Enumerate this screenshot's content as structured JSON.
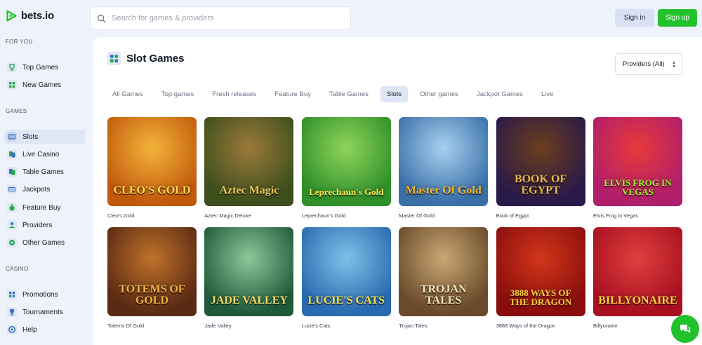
{
  "brand": {
    "name": "bets.io",
    "accent": "#22c22c"
  },
  "search": {
    "placeholder": "Search for games & providers"
  },
  "auth": {
    "signin": "Sign in",
    "signup": "Sign up"
  },
  "sidebar": {
    "sections": [
      {
        "title": "FOR YOU",
        "items": [
          {
            "label": "Top Games",
            "icon": "trophy-icon"
          },
          {
            "label": "New Games",
            "icon": "grid-icon"
          }
        ]
      },
      {
        "title": "GAMES",
        "items": [
          {
            "label": "Slots",
            "icon": "slots-icon",
            "active": true
          },
          {
            "label": "Live Casino",
            "icon": "cards-icon"
          },
          {
            "label": "Table Games",
            "icon": "table-icon"
          },
          {
            "label": "Jackpots",
            "icon": "jackpot-icon"
          },
          {
            "label": "Feature Buy",
            "icon": "bag-icon"
          },
          {
            "label": "Providers",
            "icon": "user-icon"
          },
          {
            "label": "Other Games",
            "icon": "circle-icon"
          }
        ]
      },
      {
        "title": "CASINO",
        "items": [
          {
            "label": "Promotions",
            "icon": "gift-icon"
          },
          {
            "label": "Tournaments",
            "icon": "cup-icon"
          },
          {
            "label": "Help",
            "icon": "help-icon"
          }
        ]
      }
    ]
  },
  "main": {
    "title": "Slot Games",
    "providers_select": "Providers (All)",
    "tabs": [
      "All Games",
      "Top games",
      "Fresh releases",
      "Feature Buy",
      "Table Games",
      "Slots",
      "Other games",
      "Jackpot Games",
      "Live"
    ],
    "active_tab": "Slots"
  },
  "games": [
    {
      "name": "Cleo's Gold",
      "art": "CLEO'S GOLD",
      "bg": "#c25a0c",
      "bg2": "#f3b43a",
      "fg": "#ffd84a"
    },
    {
      "name": "Aztec Magic Deluxe",
      "art": "Aztec Magic",
      "bg": "#3d4f1c",
      "bg2": "#9c7a3a",
      "fg": "#e9c65a"
    },
    {
      "name": "Leprechaun's Gold",
      "art": "Leprechaun's Gold",
      "bg": "#2f8f2a",
      "bg2": "#8fd45a",
      "fg": "#ffe14a"
    },
    {
      "name": "Master Of Gold",
      "art": "Master Of Gold",
      "bg": "#3a6fa8",
      "bg2": "#a8d0ef",
      "fg": "#f4b62d"
    },
    {
      "name": "Book of Egypt",
      "art": "BOOK OF EGYPT",
      "bg": "#2a1a4a",
      "bg2": "#6b3e1c",
      "fg": "#e8b849"
    },
    {
      "name": "Elvis Frog in Vegas",
      "art": "ELVIS FROG IN VEGAS",
      "bg": "#b01e6c",
      "bg2": "#e83a3a",
      "fg": "#9cf032"
    },
    {
      "name": "Totems Of Gold",
      "art": "TOTEMS OF GOLD",
      "bg": "#5a2a14",
      "bg2": "#c0722a",
      "fg": "#f0b040"
    },
    {
      "name": "Jade Valley",
      "art": "JADE VALLEY",
      "bg": "#1f5a3a",
      "bg2": "#8ec79a",
      "fg": "#f0d96a"
    },
    {
      "name": "Lucie's Cats",
      "art": "LUCIE'S CATS",
      "bg": "#2a6ab0",
      "bg2": "#7fc0e8",
      "fg": "#f5e04a"
    },
    {
      "name": "Trojan Tales",
      "art": "TROJAN TALES",
      "bg": "#6a4a2a",
      "bg2": "#c9a874",
      "fg": "#f3e2b4"
    },
    {
      "name": "3888 Ways of the Dragon",
      "art": "3888 WAYS OF THE DRAGON",
      "bg": "#8a0e0e",
      "bg2": "#d2361a",
      "fg": "#ffd23a"
    },
    {
      "name": "Billyonaire",
      "art": "BILLYONAIRE",
      "bg": "#a81020",
      "bg2": "#e04040",
      "fg": "#ffd23a"
    }
  ]
}
